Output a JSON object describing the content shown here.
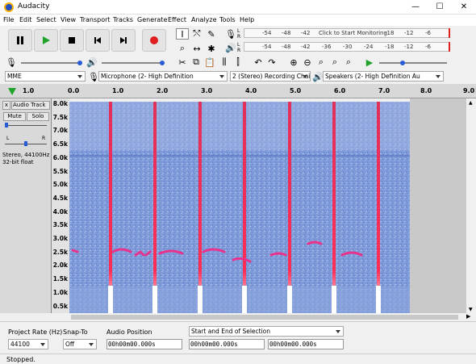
{
  "app": {
    "title": "Audacity",
    "icon": "audacity-icon"
  },
  "window": {
    "min": "—",
    "max": "☐",
    "close": "✕"
  },
  "menu": [
    "File",
    "Edit",
    "Select",
    "View",
    "Transport",
    "Tracks",
    "Generate",
    "Effect",
    "Analyze",
    "Tools",
    "Help"
  ],
  "meter": {
    "record_hint": "Click to Start Monitoring",
    "rec_ticks": [
      "-54",
      "-48",
      "-42",
      "-18",
      "-12",
      "-6"
    ],
    "play_ticks": [
      "-54",
      "-48",
      "-42",
      "-36",
      "-30",
      "-24",
      "-18",
      "-12",
      "-6"
    ],
    "L": "L",
    "R": "R"
  },
  "devices": {
    "host": "MME",
    "mic": "Microphone (2- High Definition",
    "channels": "2 (Stereo) Recording Chai",
    "speakers": "Speakers (2- High Definition Au"
  },
  "ruler": {
    "ticks": [
      "1.0",
      "0.0",
      "1.0",
      "2.0",
      "3.0",
      "4.0",
      "5.0",
      "6.0",
      "7.0",
      "8.0",
      "9.0"
    ]
  },
  "track": {
    "name": "Audio Track",
    "close": "x",
    "mute": "Mute",
    "solo": "Solo",
    "L": "L",
    "R": "R",
    "info1": "Stereo, 44100Hz",
    "info2": "32-bit float"
  },
  "freq_labels": [
    "8.0k",
    "7.5k",
    "7.0k",
    "6.5k",
    "6.0k",
    "5.5k",
    "5.0k",
    "4.5k",
    "4.0k",
    "3.5k",
    "3.0k",
    "2.5k",
    "2.0k",
    "1.5k",
    "1.0k",
    "0.5k"
  ],
  "bottom": {
    "rate_label": "Project Rate (Hz)",
    "rate_value": "44100",
    "snap_label": "Snap-To",
    "snap_value": "Off",
    "pos_label": "Audio Position",
    "pos_value": "00h00m00.000s",
    "sel_label": "Start and End of Selection",
    "sel_start": "00h00m00.000s",
    "sel_end": "00h00m00.000s"
  },
  "status": "Stopped."
}
